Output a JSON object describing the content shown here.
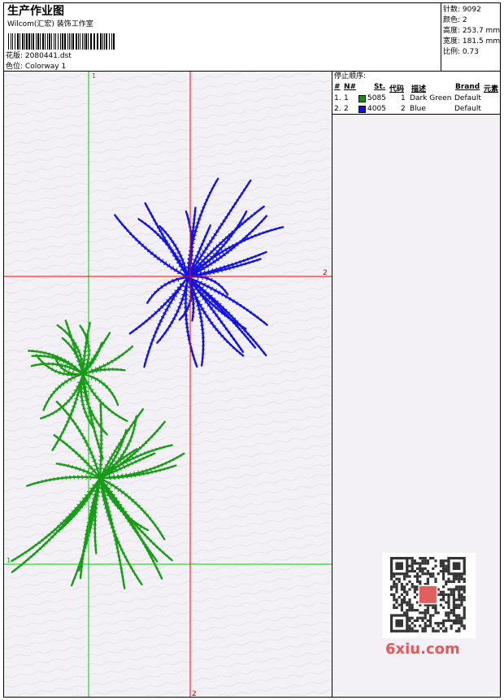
{
  "header": {
    "title": "生产作业图",
    "company": "Wilcom(汇宏) 装饰工作室",
    "design_file_label": "花版:",
    "design_file": "2080441.dst",
    "colorway_label": "色位:",
    "colorway": "Colorway 1"
  },
  "stats": {
    "stitches_label": "针数:",
    "stitches": "9092",
    "colors_label": "颜色:",
    "colors": "2",
    "height_label": "高度:",
    "height": "253.7 mm",
    "width_label": "宽度:",
    "width": "181.5 mm",
    "scale_label": "比例:",
    "scale": "0.73"
  },
  "stop_sequence": {
    "title": "停止顺序:",
    "columns": [
      "#",
      "N#",
      "St.",
      "代码",
      "描述",
      "Brand",
      "元素"
    ],
    "rows": [
      {
        "num": "1.",
        "n": "1",
        "color": "#1a8a1a",
        "stitches": "5085",
        "code": "1",
        "desc": "Dark Green",
        "brand": "Default"
      },
      {
        "num": "2.",
        "n": "2",
        "color": "#1010dd",
        "stitches": "4005",
        "code": "2",
        "desc": "Blue",
        "brand": "Default"
      }
    ]
  },
  "guides": {
    "green_label_top": "1",
    "green_label_left": "1",
    "red_label_right": "2",
    "red_label_bottom": "2"
  },
  "colors": {
    "green": "#1a9a1a",
    "blue": "#1414e0",
    "red_guide": "#ff0000",
    "green_guide": "#00cc00"
  },
  "watermark": {
    "text": "6xiu.com"
  }
}
